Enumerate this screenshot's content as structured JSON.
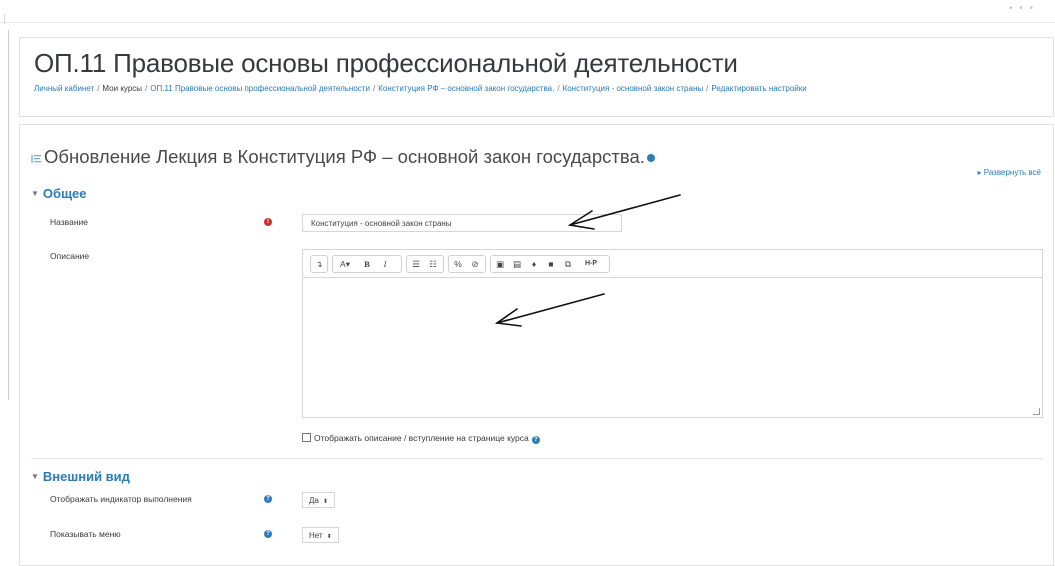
{
  "header": {
    "title": "ОП.11 Правовые основы профессиональной деятельности",
    "breadcrumb": [
      "Личный кабинет",
      "Мои курсы",
      "ОП.11 Правовые основы профессиональной деятельности",
      "Конституция РФ – основной закон государства.",
      "Конституция - основной закон страны",
      "Редактировать настройки"
    ]
  },
  "form": {
    "heading": "Обновление Лекция в Конституция РФ – основной закон государства.",
    "expand_all": "Развернуть всё",
    "general": {
      "title": "Общее",
      "name_label": "Название",
      "name_value": "Конституция - основной закон страны",
      "description_label": "Описание",
      "show_description_label": "Отображать описание / вступление на странице курса"
    },
    "appearance": {
      "title": "Внешний вид",
      "progress_label": "Отображать индикатор выполнения",
      "progress_value": "Да",
      "menu_label": "Показывать меню",
      "menu_value": "Нет"
    }
  },
  "toolbar": {
    "bold": "B",
    "italic": "I",
    "font": "A",
    "h5p": "H-P"
  },
  "colors": {
    "link": "#2b7bb9",
    "required": "#c9302c",
    "text": "#373a3c",
    "border": "#d6d6d6"
  },
  "icons": {
    "heading": "form-heading-icon",
    "required": "required-exclamation-icon",
    "help": "question-circle-icon"
  }
}
